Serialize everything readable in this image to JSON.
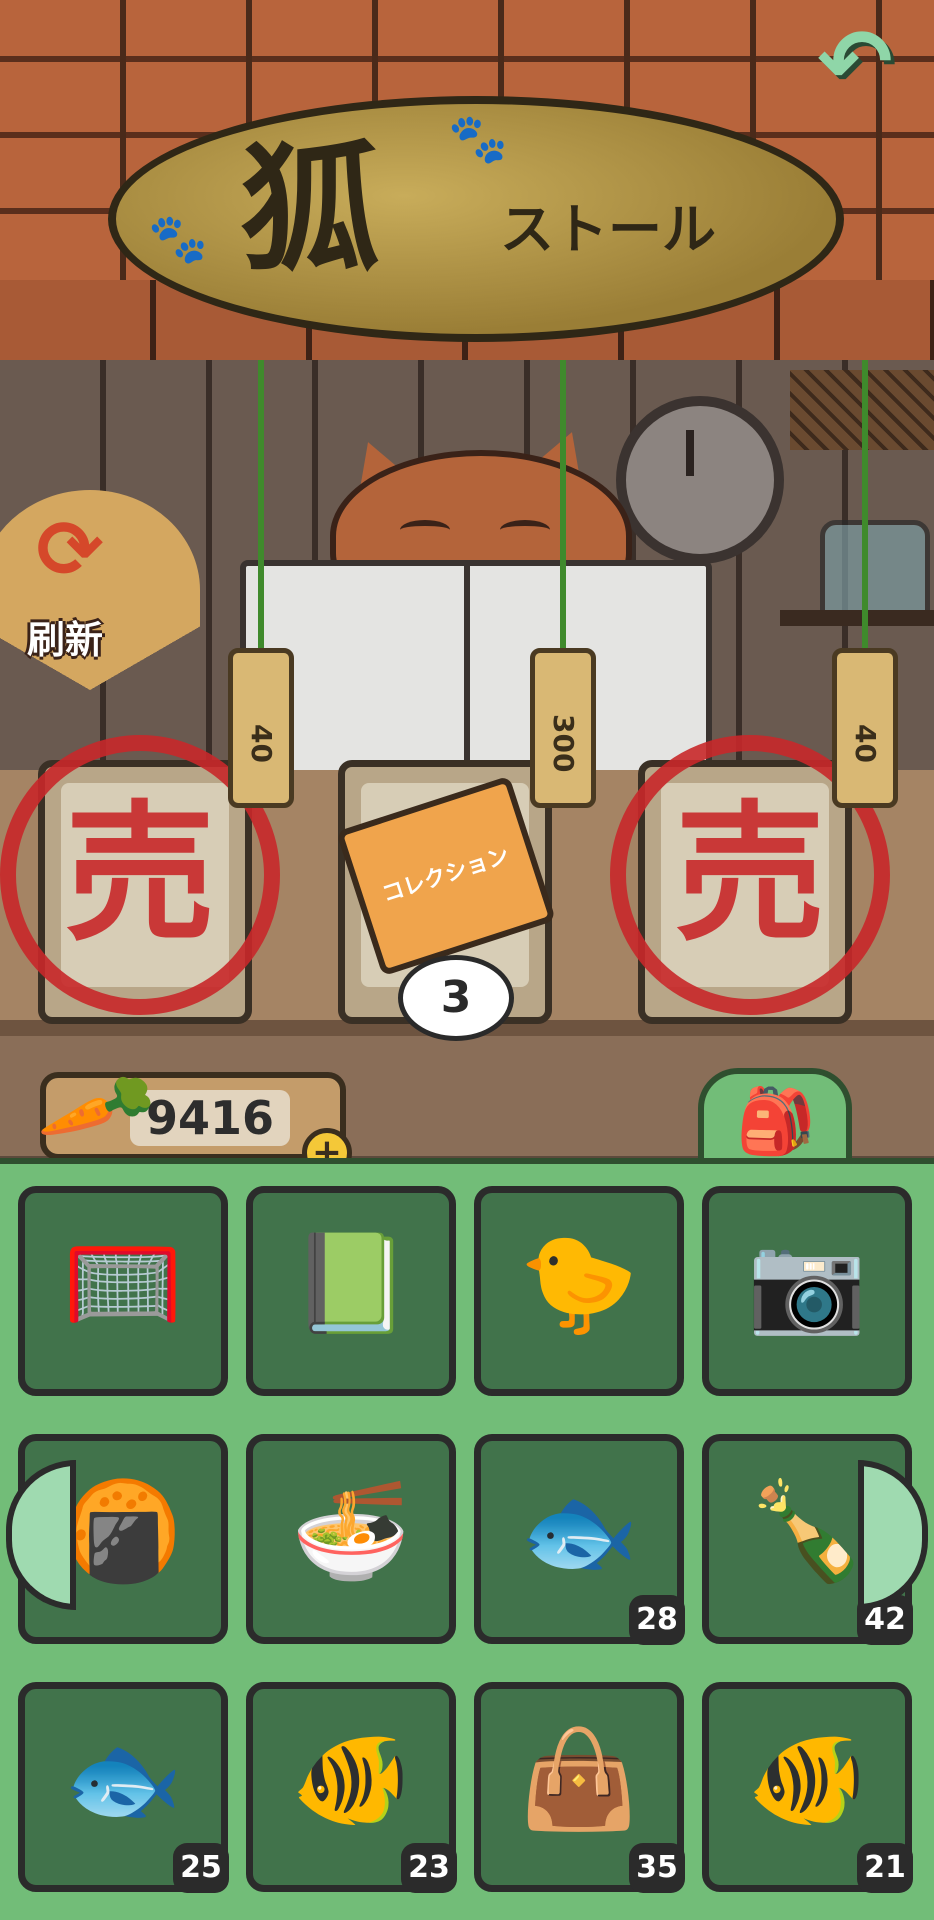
{
  "header": {
    "sign_title": "狐",
    "sign_subtitle": "ストール",
    "back_icon": "back-arrow-icon"
  },
  "refresh": {
    "label": "刷新",
    "icon": "refresh-arrows-icon"
  },
  "stall": {
    "items": [
      {
        "price": "40",
        "sold": true,
        "sold_mark": "売",
        "icon": "cracker-bag-icon"
      },
      {
        "price": "300",
        "sold": false,
        "ticket": "コレクション",
        "quantity": "3",
        "icon": "collection-ticket-icon"
      },
      {
        "price": "40",
        "sold": true,
        "sold_mark": "売",
        "icon": "cup-noodles-icon"
      }
    ]
  },
  "wallet": {
    "carrots": "9416",
    "plus": "+"
  },
  "inventory": {
    "tab_icon": "backpack-icon",
    "slots": [
      {
        "icon": "net-icon",
        "glyph": "🥅",
        "count": ""
      },
      {
        "icon": "book-icon",
        "glyph": "📗",
        "count": ""
      },
      {
        "icon": "rubber-duck-icon",
        "glyph": "🐤",
        "count": ""
      },
      {
        "icon": "camera-icon",
        "glyph": "📷",
        "count": ""
      },
      {
        "icon": "snack-bag-icon",
        "glyph": "🍘",
        "count": ""
      },
      {
        "icon": "cup-noodles-icon",
        "glyph": "🍜",
        "count": ""
      },
      {
        "icon": "sardine-icon",
        "glyph": "🐟",
        "count": "28"
      },
      {
        "icon": "plastic-bottle-icon",
        "glyph": "🍾",
        "count": "42"
      },
      {
        "icon": "mackerel-icon",
        "glyph": "🐟",
        "count": "25"
      },
      {
        "icon": "carp-icon",
        "glyph": "🐠",
        "count": "23"
      },
      {
        "icon": "trash-bag-icon",
        "glyph": "👜",
        "count": "35"
      },
      {
        "icon": "clownfish-icon",
        "glyph": "🐠",
        "count": "21"
      }
    ]
  },
  "colors": {
    "inventory_bg": "#72bd78",
    "slot_bg": "#41734b",
    "sold_red": "#c8282a",
    "roof": "#b8643c"
  }
}
